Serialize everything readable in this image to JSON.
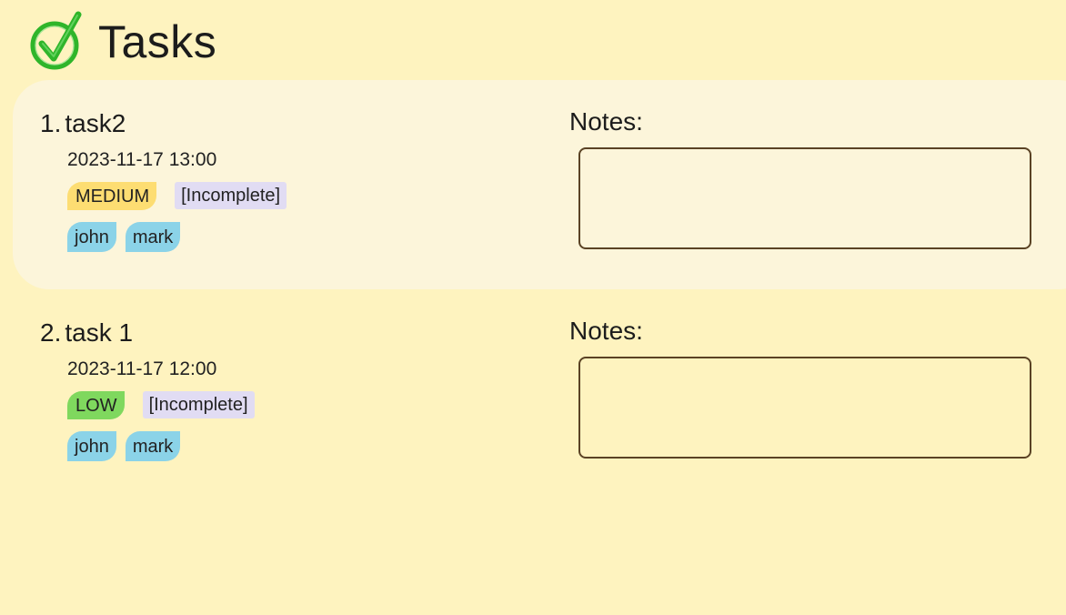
{
  "header": {
    "icon": "green-checkmark-circle-icon",
    "title": "Tasks"
  },
  "colors": {
    "background": "#fef3bf",
    "selected_card": "#fcf5da",
    "priority_medium": "#fddd72",
    "priority_low": "#7fd85e",
    "status_bg": "#e1dcf3",
    "tag_bg": "#8bd3e8",
    "notes_border": "#5a4224",
    "check_green": "#2fb52a"
  },
  "tasks": [
    {
      "index": "1.",
      "name": "task2",
      "datetime": "2023-11-17 13:00",
      "priority": "MEDIUM",
      "status": "[Incomplete]",
      "tags": [
        "john",
        "mark"
      ],
      "notes_label": "Notes:",
      "notes": ""
    },
    {
      "index": "2.",
      "name": "task 1",
      "datetime": "2023-11-17 12:00",
      "priority": "LOW",
      "status": "[Incomplete]",
      "tags": [
        "john",
        "mark"
      ],
      "notes_label": "Notes:",
      "notes": ""
    }
  ]
}
